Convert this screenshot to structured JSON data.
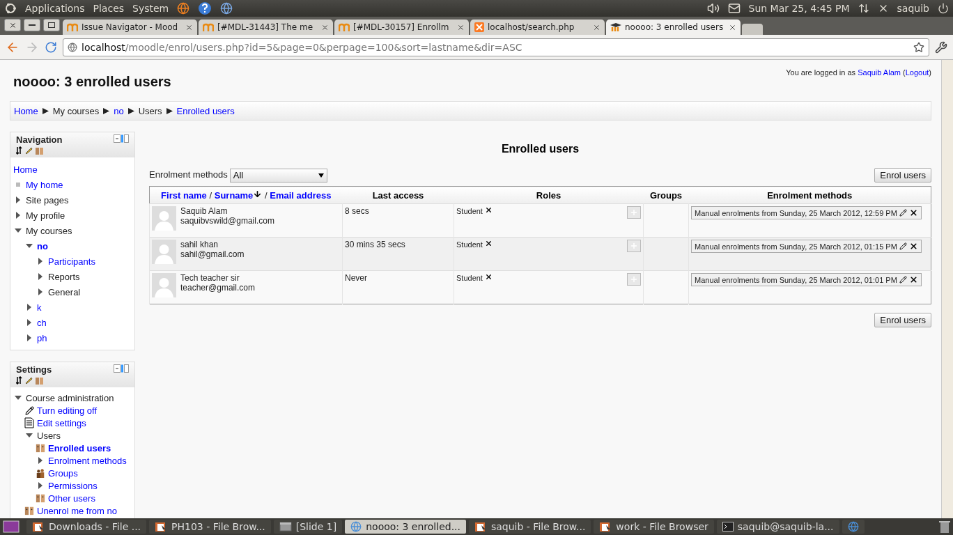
{
  "top_panel": {
    "menus": [
      "Applications",
      "Places",
      "System"
    ],
    "clock": "Sun Mar 25,  4:45 PM",
    "user": "saquib"
  },
  "browser": {
    "tabs": [
      {
        "title": "Issue Navigator - Mood",
        "kind": "moodle",
        "selected": false
      },
      {
        "title": "[#MDL-31443] The me",
        "kind": "moodle",
        "selected": false
      },
      {
        "title": "[#MDL-30157] Enrollm",
        "kind": "moodle",
        "selected": false
      },
      {
        "title": "localhost/search.php",
        "kind": "xampp",
        "selected": false
      },
      {
        "title": "noooo: 3 enrolled users",
        "kind": "course",
        "selected": true
      }
    ],
    "url_host": "localhost",
    "url_path": "/moodle/enrol/users.php?id=5&page=0&perpage=100&sort=lastname&dir=ASC"
  },
  "page": {
    "heading": "noooo: 3 enrolled users",
    "login": {
      "text": "You are logged in as",
      "user": "Saquib Alam",
      "open": "(",
      "logout": "Logout",
      "close": ")"
    },
    "breadcrumb": [
      {
        "label": "Home",
        "link": true
      },
      {
        "label": "My courses",
        "link": false
      },
      {
        "label": "no",
        "link": true
      },
      {
        "label": "Users",
        "link": false
      },
      {
        "label": "Enrolled users",
        "link": true
      }
    ],
    "navigation": {
      "title": "Navigation",
      "items": [
        {
          "label": "Home",
          "kind": "plain",
          "link": true,
          "selected": false
        },
        {
          "label": "My home",
          "kind": "bullet",
          "link": true,
          "selected": false
        },
        {
          "label": "Site pages",
          "kind": "branch",
          "expanded": false,
          "link": false,
          "selected": false
        },
        {
          "label": "My profile",
          "kind": "branch",
          "expanded": false,
          "link": false,
          "selected": false
        },
        {
          "label": "My courses",
          "kind": "branch",
          "expanded": true,
          "link": false,
          "selected": false,
          "children": [
            {
              "label": "no",
              "kind": "branch",
              "expanded": true,
              "link": true,
              "selected": true,
              "children": [
                {
                  "label": "Participants",
                  "kind": "branch",
                  "expanded": false,
                  "link": true,
                  "selected": false
                },
                {
                  "label": "Reports",
                  "kind": "branch",
                  "expanded": false,
                  "link": false,
                  "selected": false
                },
                {
                  "label": "General",
                  "kind": "branch",
                  "expanded": false,
                  "link": false,
                  "selected": false
                }
              ]
            },
            {
              "label": "k",
              "kind": "branch",
              "expanded": false,
              "link": true,
              "selected": false
            },
            {
              "label": "ch",
              "kind": "branch",
              "expanded": false,
              "link": true,
              "selected": false
            },
            {
              "label": "ph",
              "kind": "branch",
              "expanded": false,
              "link": true,
              "selected": false
            }
          ]
        }
      ]
    },
    "settings": {
      "title": "Settings",
      "items": [
        {
          "label": "Course administration",
          "kind": "branch",
          "expanded": true,
          "link": false,
          "selected": false,
          "children": [
            {
              "label": "Turn editing off",
              "kind": "toggle",
              "link": true,
              "selected": false
            },
            {
              "label": "Edit settings",
              "kind": "settings",
              "link": true,
              "selected": false
            },
            {
              "label": "Users",
              "kind": "branch",
              "expanded": true,
              "link": false,
              "selected": false,
              "children": [
                {
                  "label": "Enrolled users",
                  "kind": "users",
                  "link": true,
                  "selected": true
                },
                {
                  "label": "Enrolment methods",
                  "kind": "branch",
                  "expanded": false,
                  "link": true,
                  "selected": false
                },
                {
                  "label": "Groups",
                  "kind": "groups",
                  "link": true,
                  "selected": false
                },
                {
                  "label": "Permissions",
                  "kind": "branch",
                  "expanded": false,
                  "link": true,
                  "selected": false
                },
                {
                  "label": "Other users",
                  "kind": "users",
                  "link": true,
                  "selected": false
                }
              ]
            },
            {
              "label": "Unenrol me from no",
              "kind": "users",
              "link": true,
              "selected": false
            }
          ]
        }
      ]
    },
    "main": {
      "title": "Enrolled users",
      "filter_label": "Enrolment methods",
      "filter_value": "All",
      "enrol_buttons": [
        "Enrol users",
        "Enrol users"
      ],
      "columns": [
        {
          "kind": "sortable",
          "parts": [
            {
              "label": "First name",
              "sorted": false
            },
            {
              "label": "Surname",
              "sorted": true
            },
            {
              "label": "Email address",
              "sorted": false
            }
          ],
          "separators": [
            "/",
            "/"
          ]
        },
        {
          "kind": "plain",
          "label": "Last access"
        },
        {
          "kind": "plain",
          "label": "Roles"
        },
        {
          "kind": "plain",
          "label": "Groups"
        },
        {
          "kind": "plain",
          "label": "Enrolment methods"
        }
      ],
      "rows": [
        {
          "name": "Saquib Alam",
          "email": "saquibvswild@gmail.com",
          "last_access": "8 secs",
          "role": "Student",
          "enrolment": "Manual enrolments from Sunday, 25 March 2012, 12:59 PM"
        },
        {
          "name": "sahil khan",
          "email": "sahil@gmail.com",
          "last_access": "30 mins 35 secs",
          "role": "Student",
          "enrolment": "Manual enrolments from Sunday, 25 March 2012, 01:15 PM"
        },
        {
          "name": "Tech teacher sir",
          "email": "teacher@gmail.com",
          "last_access": "Never",
          "role": "Student",
          "enrolment": "Manual enrolments from Sunday, 25 March 2012, 01:01 PM"
        }
      ]
    }
  },
  "taskbar": [
    {
      "label": "Downloads - File ...",
      "kind": "folder",
      "selected": false
    },
    {
      "label": "PH103 - File Brow...",
      "kind": "folder",
      "selected": false
    },
    {
      "label": "[Slide 1]",
      "kind": "slides",
      "selected": false
    },
    {
      "label": "noooo: 3 enrolled...",
      "kind": "browser",
      "selected": true
    },
    {
      "label": "saquib - File Brow...",
      "kind": "folder",
      "selected": false
    },
    {
      "label": "work - File Browser",
      "kind": "folder",
      "selected": false
    },
    {
      "label": "saquib@saquib-la...",
      "kind": "terminal",
      "selected": false
    },
    {
      "kind": "browser",
      "selected": false
    }
  ]
}
